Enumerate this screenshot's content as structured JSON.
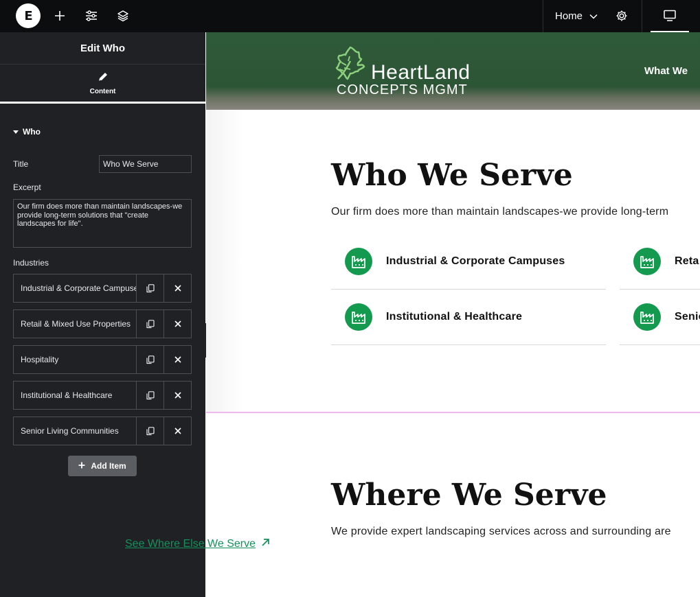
{
  "topbar": {
    "logo_letter": "E",
    "home_label": "Home"
  },
  "panel": {
    "header_title": "Edit Who",
    "tab_content": "Content",
    "section_title": "Who",
    "title_label": "Title",
    "title_value": "Who We Serve",
    "excerpt_label": "Excerpt",
    "excerpt_value": "Our firm does more than maintain landscapes-we provide long-term solutions that \"create landscapes for life\".",
    "industries_label": "Industries",
    "industries": [
      {
        "label": "Industrial & Corporate Campuses"
      },
      {
        "label": "Retail & Mixed Use Properties"
      },
      {
        "label": "Hospitality"
      },
      {
        "label": "Institutional & Healthcare"
      },
      {
        "label": "Senior Living Communities"
      }
    ],
    "add_item_label": "Add Item"
  },
  "preview": {
    "brand_top": "HeartLand",
    "brand_bottom": "CONCEPTS MGMT",
    "nav_item": "What We",
    "who_heading": "Who We Serve",
    "who_lead": "Our firm does more than maintain landscapes-we provide long-term",
    "cards": [
      {
        "label": "Industrial & Corporate Campuses"
      },
      {
        "label": "Reta"
      },
      {
        "label": "Institutional & Healthcare"
      },
      {
        "label": "Senio"
      }
    ],
    "where_heading": "Where We Serve",
    "where_lead": "We provide expert landscaping services across and surrounding are",
    "see_link": "See Where Else We Serve"
  },
  "colors": {
    "accent_green": "#149a4f",
    "panel_bg": "#1f2124",
    "topbar_bg": "#0c0d0e",
    "link_green": "#15905a"
  },
  "icons": [
    "elementor-logo",
    "plus-icon",
    "sliders-icon",
    "layers-icon",
    "chevron-down-icon",
    "gear-icon",
    "desktop-icon",
    "pencil-icon",
    "duplicate-icon",
    "close-icon",
    "factory-icon",
    "arrow-up-right-icon"
  ]
}
